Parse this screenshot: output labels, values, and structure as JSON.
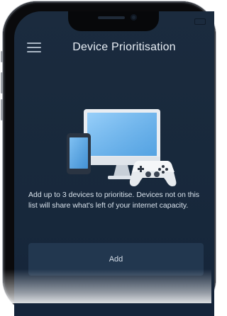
{
  "header": {
    "title": "Device Prioritisation"
  },
  "main": {
    "description": "Add up to 3 devices to prioritise. Devices not on this list will share what's left of your internet capacity.",
    "add_button_label": "Add"
  },
  "icons": [
    "menu-icon",
    "phone-icon",
    "monitor-icon",
    "game-controller-icon"
  ],
  "colors": {
    "background": "#1b2b3e",
    "button": "#22374f",
    "text": "#e8eef5"
  }
}
